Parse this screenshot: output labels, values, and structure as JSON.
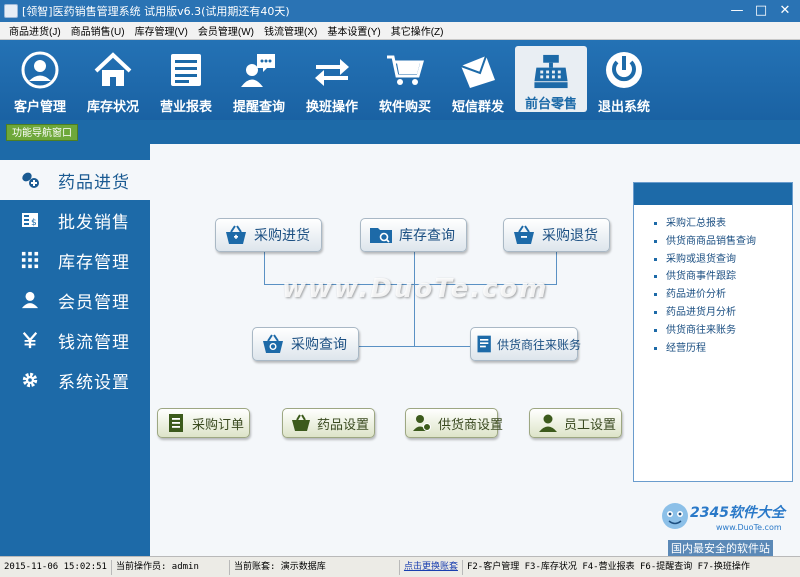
{
  "window": {
    "title": "[领智]医药销售管理系统 试用版v6.3(试用期还有40天)"
  },
  "menu": [
    "商品进货(J)",
    "商品销售(U)",
    "库存管理(V)",
    "会员管理(W)",
    "钱流管理(X)",
    "基本设置(Y)",
    "其它操作(Z)"
  ],
  "toolbar": {
    "items": [
      {
        "label": "客户管理",
        "icon": "user-circle-icon"
      },
      {
        "label": "库存状况",
        "icon": "house-icon"
      },
      {
        "label": "营业报表",
        "icon": "report-icon"
      },
      {
        "label": "提醒查询",
        "icon": "chat-user-icon"
      },
      {
        "label": "换班操作",
        "icon": "swap-arrows-icon"
      },
      {
        "label": "软件购买",
        "icon": "shopping-cart-icon"
      },
      {
        "label": "短信群发",
        "icon": "envelope-icon"
      },
      {
        "label": "前台零售",
        "icon": "cash-register-icon"
      },
      {
        "label": "退出系统",
        "icon": "power-icon"
      }
    ],
    "active": "前台零售"
  },
  "nav_tag": "功能导航窗口",
  "sidebar": {
    "items": [
      {
        "label": "药品进货",
        "icon": "pills-icon"
      },
      {
        "label": "批发销售",
        "icon": "invoice-icon"
      },
      {
        "label": "库存管理",
        "icon": "grid-icon"
      },
      {
        "label": "会员管理",
        "icon": "person-icon"
      },
      {
        "label": "钱流管理",
        "icon": "yen-icon"
      },
      {
        "label": "系统设置",
        "icon": "gear-icon"
      }
    ],
    "active": "药品进货"
  },
  "flow": {
    "purchase_in": "采购进货",
    "stock_query": "库存查询",
    "purchase_return": "采购退货",
    "purchase_query": "采购查询",
    "supplier_accounts": "供货商往来账务",
    "purchase_order": "采购订单",
    "drug_setup": "药品设置",
    "supplier_setup": "供货商设置",
    "staff_setup": "员工设置"
  },
  "right_panel": {
    "links": [
      "采购汇总报表",
      "供货商商品销售查询",
      "采购或退货查询",
      "供货商事件跟踪",
      "药品进价分析",
      "药品进货月分析",
      "供货商往来账务",
      "经营历程"
    ]
  },
  "watermark": "www.DuoTe.com",
  "brand": {
    "top": "2345软件大全",
    "url": "www.DuoTe.com",
    "bottom": "国内最安全的软件站"
  },
  "status": {
    "datetime": "2015-11-06 15:02:51",
    "operator": "当前操作员: admin",
    "account": "当前账套: 演示数据库",
    "switch_link": "点击更换账套",
    "shortcuts": "F2-客户管理 F3-库存状况 F4-营业报表 F6-提醒查询 F7-换班操作"
  }
}
